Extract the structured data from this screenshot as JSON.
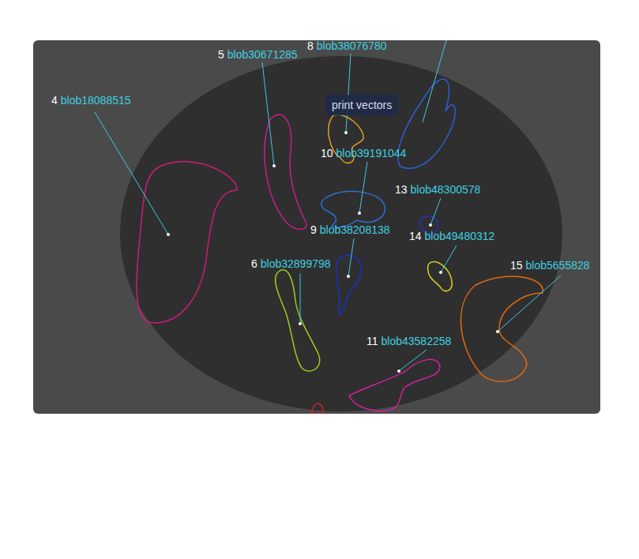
{
  "panel": {
    "button": {
      "label": "print vectors"
    }
  },
  "blobs": [
    {
      "number": "4",
      "name": "blob18088515",
      "color": "#d01a78"
    },
    {
      "number": "5",
      "name": "blob30671285",
      "color": "#c81e8c"
    },
    {
      "number": "8",
      "name": "blob38076780",
      "color": "#e0a020"
    },
    {
      "number": "10",
      "name": "blob39191044",
      "color": "#2a6fd0"
    },
    {
      "number": "13",
      "name": "blob48300578",
      "color": "#2233cc"
    },
    {
      "number": "9",
      "name": "blob38208138",
      "color": "#1a2fc8"
    },
    {
      "number": "14",
      "name": "blob49480312",
      "color": "#d8d020"
    },
    {
      "number": "6",
      "name": "blob32899798",
      "color": "#9acd20"
    },
    {
      "number": "15",
      "name": "blob5655828",
      "color": "#e06a10"
    },
    {
      "number": "11",
      "name": "blob43582258",
      "color": "#d020a0"
    }
  ],
  "unlabeled_blobs": [
    {
      "color": "#2a5fd8"
    },
    {
      "color": "#d02030"
    }
  ]
}
